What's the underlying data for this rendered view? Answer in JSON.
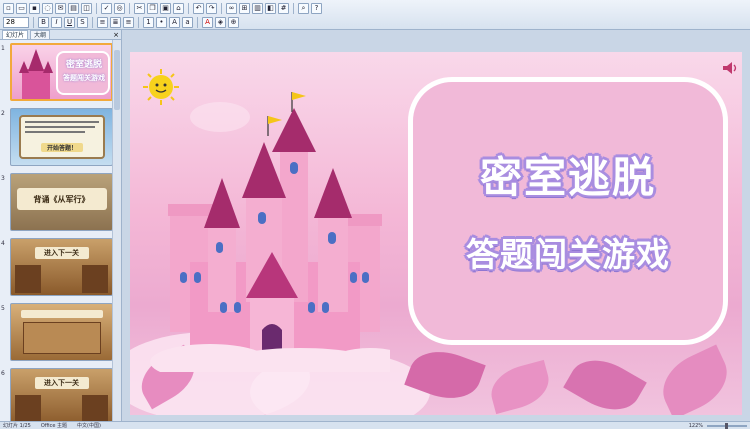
{
  "toolbar": {
    "font_size": "28",
    "row1_icons": [
      "new-icon",
      "open-icon",
      "save-icon",
      "permission-icon",
      "mail-icon",
      "print-icon",
      "preview-icon",
      "spell-icon",
      "research-icon",
      "cut-icon",
      "copy-icon",
      "paste-icon",
      "format-painter-icon",
      "undo-icon",
      "redo-icon",
      "hyperlink-icon",
      "table-icon",
      "chart-icon",
      "insert-icon",
      "grid-icon",
      "zoom-icon",
      "help-icon"
    ],
    "row2_icons": [
      "bold-icon",
      "italic-icon",
      "underline-icon",
      "shadow-icon",
      "align-left-icon",
      "center-icon",
      "align-right-icon",
      "numbering-icon",
      "bullets-icon",
      "increase-font-icon",
      "decrease-font-icon",
      "font-color-icon",
      "design-icon",
      "new-slide-icon"
    ]
  },
  "left_panel": {
    "tabs": [
      {
        "label": "幻灯片"
      },
      {
        "label": "大纲"
      }
    ],
    "close_label": "×",
    "thumbnails": [
      {
        "number": "1",
        "line1": "密室逃脱",
        "line2": "答题闯关游戏"
      },
      {
        "number": "2",
        "line1": "",
        "line2": "开始答题！"
      },
      {
        "number": "3",
        "line1": "背诵《从军行》",
        "line2": ""
      },
      {
        "number": "4",
        "line1": "进入下一关",
        "line2": ""
      },
      {
        "number": "5",
        "line1": "",
        "line2": ""
      },
      {
        "number": "6",
        "line1": "进入下一关",
        "line2": ""
      }
    ]
  },
  "slide": {
    "title1": "密室逃脱",
    "title2": "答题闯关游戏",
    "panel_color": "#f1b9d8",
    "title_outline_color": "#a98de0"
  },
  "status_bar": {
    "slide_info": "幻灯片 1/25",
    "theme": "Office 主题",
    "language": "中文(中国)",
    "zoom": "122%"
  }
}
